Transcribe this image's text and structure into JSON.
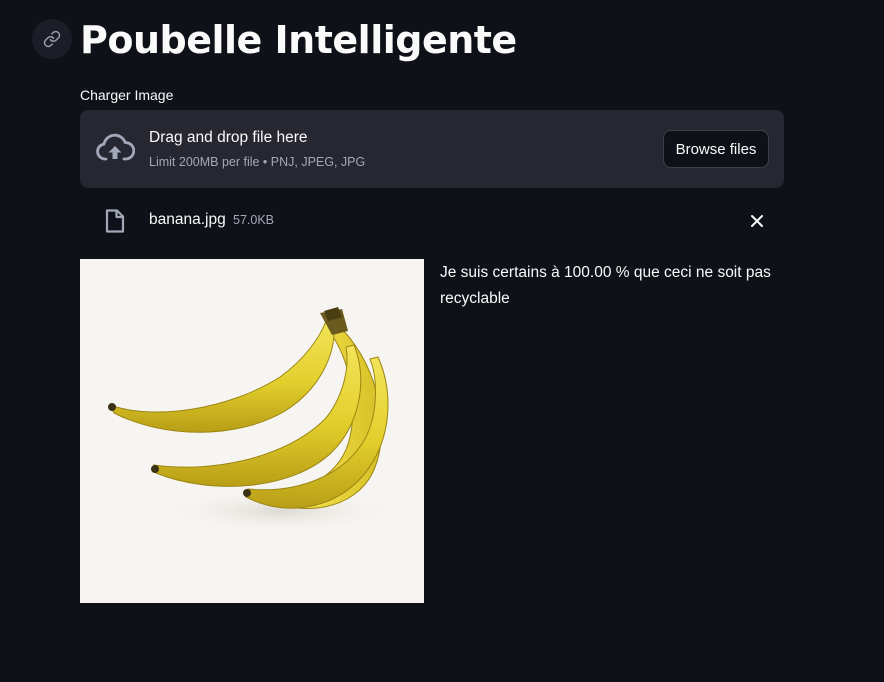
{
  "header": {
    "title": "Poubelle Intelligente",
    "anchor_icon": "link-icon"
  },
  "uploader": {
    "label": "Charger Image",
    "dropzone_main": "Drag and drop file here",
    "dropzone_sub": "Limit 200MB per file • PNJ, JPEG, JPG",
    "browse_label": "Browse files",
    "upload_icon": "cloud-upload-icon"
  },
  "uploaded_file": {
    "name": "banana.jpg",
    "size": "57.0KB",
    "icon": "file-icon",
    "remove_icon": "close-icon"
  },
  "result": {
    "text": "Je suis certains à 100.00 % que ceci ne soit pas recyclable"
  },
  "colors": {
    "background": "#0e1117",
    "dropzone": "#262730",
    "text": "#fafafa",
    "muted_text": "#a3a8b8"
  }
}
